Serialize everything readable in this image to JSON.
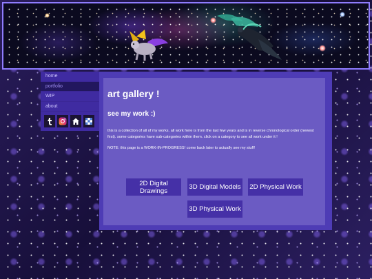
{
  "sidebar": {
    "items": [
      {
        "label": "home"
      },
      {
        "label": "portfolio"
      },
      {
        "label": "WIP"
      },
      {
        "label": "about"
      }
    ],
    "active_index": 1,
    "social_icons": [
      "tumblr-icon",
      "instagram-icon",
      "house-icon",
      "checker-icon"
    ]
  },
  "main": {
    "title": "art gallery !",
    "subtitle": "see my work :)",
    "paragraph": "this is a collection of all of my works. all work here is from the last few years and is in reverse chronological order (newest first). some categories have sub-categories within them. click on a category to see all work under it !",
    "note": "NOTE: this page is a WORK-IN-PROGRESS! come back later to actually see my stuff!",
    "categories": [
      {
        "label": "2D Digital Drawings"
      },
      {
        "label": "3D Digital Models"
      },
      {
        "label": "2D Physical Work"
      },
      {
        "label": "3D Physical Work"
      }
    ]
  },
  "colors": {
    "banner_border": "#8f7cff",
    "sidebar_bg": "#3f2ba1",
    "content_bg": "#6b5bc3",
    "button_bg": "#4530a7"
  }
}
